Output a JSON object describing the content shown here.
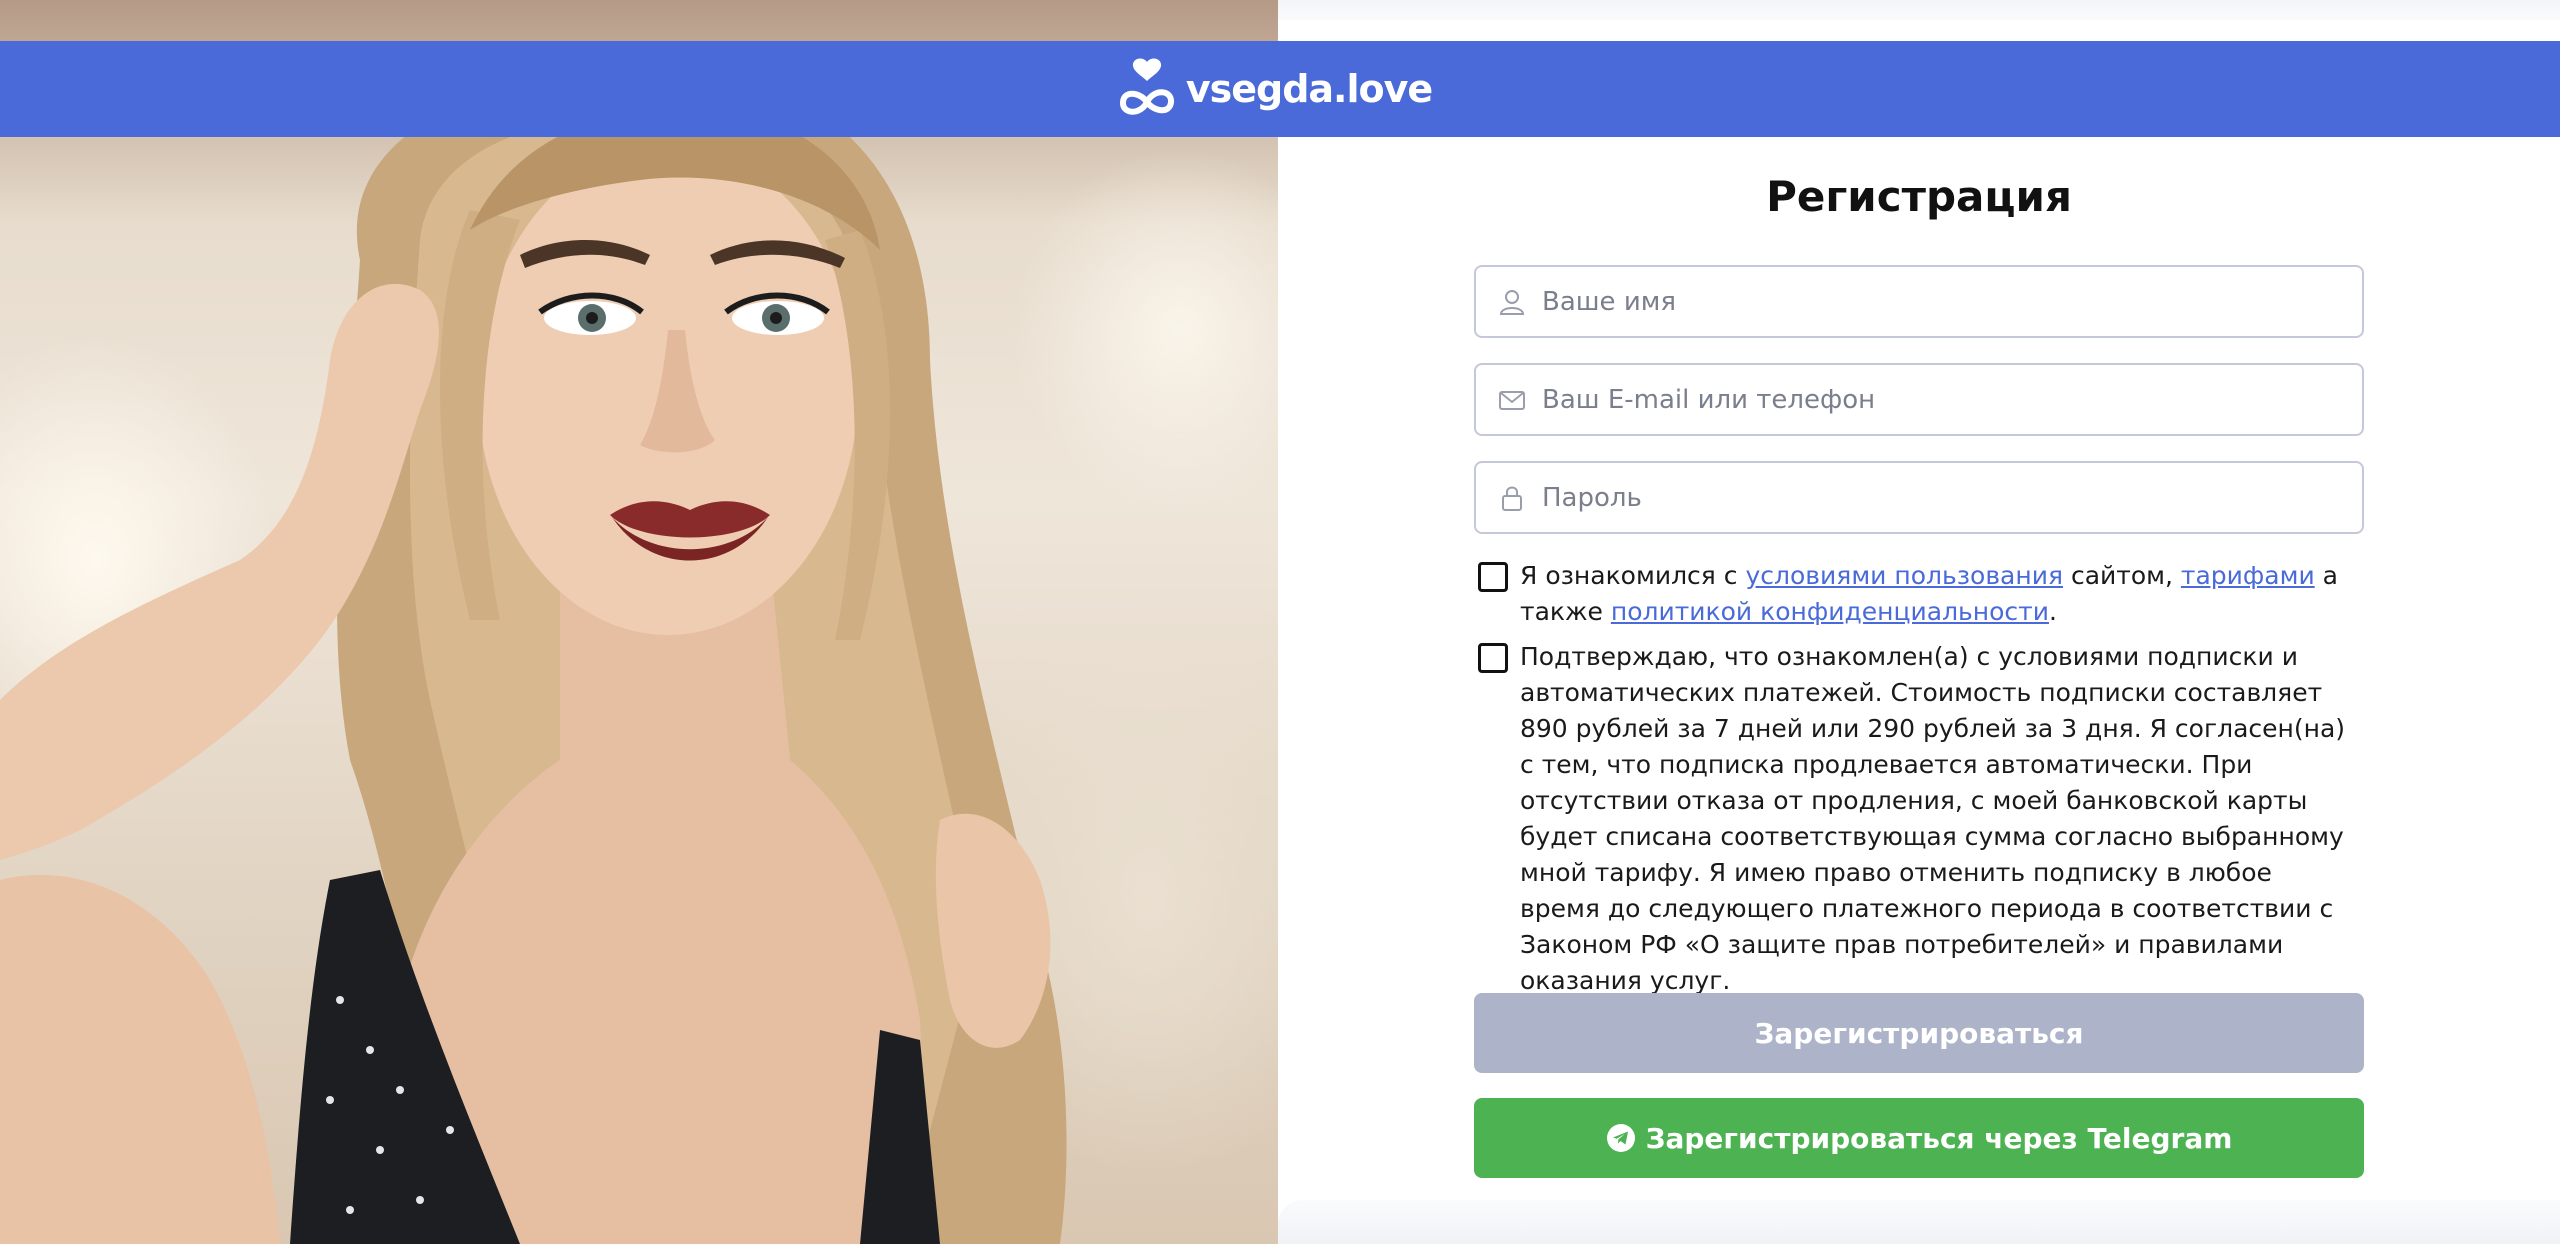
{
  "header": {
    "logo_text": "vsegda.love",
    "background_color": "#4a6ad9"
  },
  "form": {
    "title": "Регистрация",
    "name_field": {
      "placeholder": "Ваше имя",
      "icon": "user-icon"
    },
    "contact_field": {
      "placeholder": "Ваш E-mail или телефон",
      "icon": "envelope-icon"
    },
    "password_field": {
      "placeholder": "Пароль",
      "icon": "lock-icon"
    },
    "terms_agreement": {
      "text_1": "Я ознакомился с ",
      "link_terms": "условиями пользования",
      "text_2": " сайтом, ",
      "link_tariffs": "тарифами",
      "text_3": " а также ",
      "link_privacy": "политикой конфиденциальности",
      "text_4": "."
    },
    "subscription_agreement": {
      "text": "Подтверждаю, что ознакомлен(а) с условиями подписки и автоматических платежей. Стоимость подписки составляет 890 рублей за 7 дней или 290 рублей за 3 дня. Я согласен(на) с тем, что подписка продлевается автоматически. При отсутствии отказа от продления, с моей банковской карты будет списана соответствующая сумма согласно выбранному мной тарифу. Я имею право отменить подписку в любое время до следующего платежного периода в соответствии с Законом РФ «О защите прав потребителей» и правилами оказания услуг."
    },
    "register_button": {
      "label": "Зарегистрироваться",
      "color": "#adb3c8"
    },
    "telegram_button": {
      "label": "Зарегистрироваться через Telegram",
      "icon": "telegram-icon",
      "color": "#4db251"
    }
  }
}
